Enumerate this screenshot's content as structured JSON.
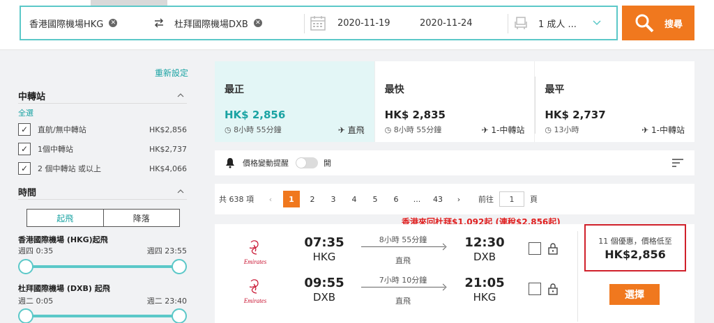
{
  "search": {
    "origin": "香港國際機場HKG",
    "destination": "杜拜國際機場DXB",
    "depart_date": "2020-11-19",
    "return_date": "2020-11-24",
    "passengers": "1 成人 ...",
    "search_label": "搜尋"
  },
  "sidebar": {
    "reset_label": "重新設定",
    "stops": {
      "title": "中轉站",
      "select_all": "全選",
      "options": [
        {
          "label": "直航/無中轉站",
          "price": "HK$2,856",
          "checked": true
        },
        {
          "label": "1個中轉站",
          "price": "HK$2,737",
          "checked": true
        },
        {
          "label": "2 個中轉站 或以上",
          "price": "HK$4,066",
          "checked": true
        }
      ]
    },
    "time": {
      "title": "時間",
      "toggle_depart": "起飛",
      "toggle_arrive": "降落",
      "outbound_label": "香港國際機場 (HKG)起飛",
      "outbound_min": "週四 0:35",
      "outbound_max": "週四 23:55",
      "return_label": "杜拜國際機場 (DXB) 起飛",
      "return_min": "週二 0:05",
      "return_max": "週二 23:40"
    }
  },
  "summary": [
    {
      "title": "最正",
      "price": "HK$ 2,856",
      "duration": "8小時 55分鐘",
      "stops": "直飛",
      "active": true
    },
    {
      "title": "最快",
      "price": "HK$ 2,835",
      "duration": "8小時 55分鐘",
      "stops": "1-中轉站",
      "active": false
    },
    {
      "title": "最平",
      "price": "HK$ 2,737",
      "duration": "13小時",
      "stops": "1-中轉站",
      "active": false
    }
  ],
  "alert": {
    "label": "價格變動提醒",
    "state": "開"
  },
  "pager": {
    "total": "共 638 項",
    "pages": [
      "1",
      "2",
      "3",
      "4",
      "5",
      "6",
      "...",
      "43"
    ],
    "current": "1",
    "goto_prefix": "前往",
    "goto_value": "1",
    "goto_suffix": "頁"
  },
  "promo_text": "香港來回杜拜$1,092起 (連稅$2,856起)",
  "flight": {
    "airline": "Emirates",
    "legs": [
      {
        "dep_time": "07:35",
        "dep_code": "HKG",
        "duration": "8小時 55分鐘",
        "stops": "直飛",
        "arr_time": "12:30",
        "arr_code": "DXB"
      },
      {
        "dep_time": "09:55",
        "dep_code": "DXB",
        "duration": "7小時 10分鐘",
        "stops": "直飛",
        "arr_time": "21:05",
        "arr_code": "HKG"
      }
    ],
    "deal_label": "11 個優惠，價格低至",
    "deal_price": "HK$2,856",
    "choose_label": "選擇"
  },
  "colors": {
    "accent": "#5bc8c8",
    "orange": "#f0781e",
    "red": "#d0202a"
  }
}
